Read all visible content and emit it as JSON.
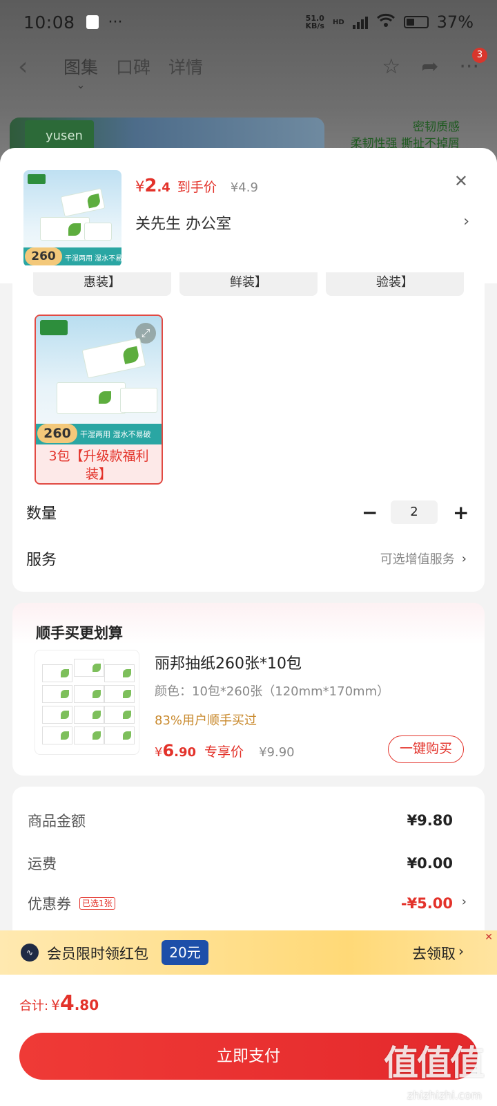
{
  "status_bar": {
    "time": "10:08",
    "dots": "···",
    "net_speed": "51.0",
    "net_unit": "KB/s",
    "net_type": "HD",
    "battery": "37%"
  },
  "top_nav": {
    "back_icon": "back-icon",
    "tabs": [
      "图集",
      "口碑",
      "详情"
    ],
    "active_tab": 0,
    "cart_badge": "3"
  },
  "banner": {
    "brand": "yusen",
    "tagline_1": "密韧质感",
    "tagline_2": "柔韧性强 撕扯不掉屑"
  },
  "sheet": {
    "thumb": {
      "sheets": "260",
      "sheets_unit": "张",
      "caption": "干湿两用 湿水不易破",
      "badge": "尺寸升级"
    },
    "price": {
      "yen": "¥",
      "int": "2",
      "dec": ".4",
      "label": "到手价",
      "original": "¥4.9"
    },
    "address": "关先生  办公室",
    "close_icon": "close-icon",
    "chips": [
      "惠装】",
      "鲜装】",
      "验装】"
    ],
    "sku": {
      "sheets": "260",
      "caption": "干湿两用 湿水不易破",
      "badge": "尺寸升级",
      "label": "3包【升级款福利装】"
    },
    "quantity": {
      "label": "数量",
      "minus": "−",
      "plus": "+",
      "value": "2"
    },
    "service": {
      "label": "服务",
      "value": "可选增值服务"
    }
  },
  "addon": {
    "title": "顺手买更划算",
    "name": "丽邦抽纸260张*10包",
    "spec": "颜色：10包*260张（120mm*170mm）",
    "percent": "83%用户顺手买过",
    "price": {
      "yen": "¥",
      "int": "6",
      "dec": ".90",
      "label": "专享价",
      "original": "¥9.90"
    },
    "button": "一键购买"
  },
  "summary": [
    {
      "label": "商品金额",
      "value": "¥9.80"
    },
    {
      "label": "运费",
      "value": "¥0.00"
    },
    {
      "label": "优惠券",
      "tag": "已选1张",
      "value": "-¥5.00"
    }
  ],
  "member": {
    "text": "会员限时领红包",
    "amount": "20元",
    "action": "去领取"
  },
  "footer": {
    "total_label": "合计:",
    "yen": "¥",
    "int": "4",
    "dec": ".80",
    "pay": "立即支付"
  },
  "watermark": {
    "zh": "值值值",
    "en": "zhizhizhi.com"
  },
  "colors": {
    "accent": "#e3322a",
    "member_bg": "#ffd977",
    "member_badge": "#1d4fa9"
  }
}
